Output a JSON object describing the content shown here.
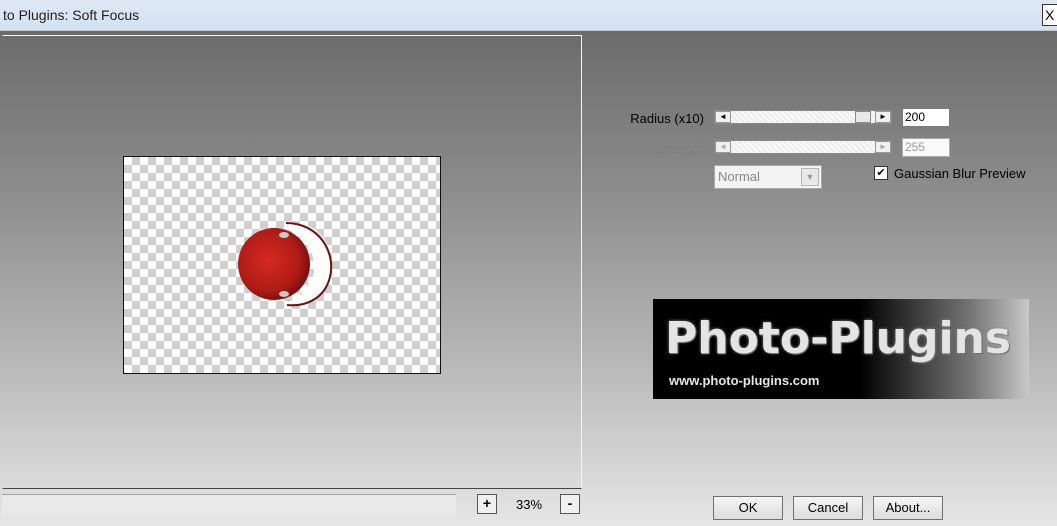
{
  "window": {
    "title": "to Plugins: Soft Focus",
    "close_glyph": "X"
  },
  "preview": {
    "zoom_in_label": "+",
    "zoom_value": "33%",
    "zoom_out_label": "-"
  },
  "controls": {
    "radius": {
      "label": "Radius (x10)",
      "value": "200",
      "level": 0.95,
      "left_arrow": "◄",
      "right_arrow": "►"
    },
    "strength": {
      "label": "Strength",
      "value": "255",
      "enabled": false,
      "left_arrow": "◄",
      "right_arrow": "►"
    },
    "mode_select": {
      "value": "Normal",
      "arrow": "▼",
      "enabled": false
    },
    "gaussian_preview": {
      "label": "Gaussian Blur Preview",
      "checked": true,
      "mark": "✔"
    }
  },
  "banner": {
    "title": "Photo-Plugins",
    "url": "www.photo-plugins.com"
  },
  "buttons": {
    "ok": "OK",
    "cancel": "Cancel",
    "about": "About..."
  },
  "colors": {
    "sphere": "#c0221b",
    "sphere_dark": "#6e0f0c"
  }
}
